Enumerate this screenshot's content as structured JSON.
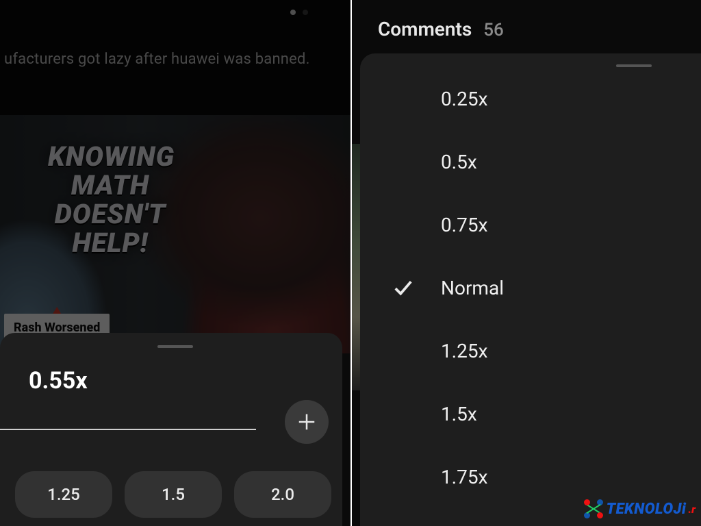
{
  "left": {
    "page_indicator": {
      "count": 2,
      "active": 0
    },
    "comment_preview": "ufacturers got lazy after huawei was banned.",
    "thumbnail": {
      "title_lines": [
        "KNOWING",
        "MATH",
        "DOESN'T",
        "HELP!"
      ],
      "badge": "Rash Worsened"
    },
    "speed_sheet": {
      "current": "0.55x",
      "plus_icon_name": "plus-icon",
      "chips": [
        "1.25",
        "1.5",
        "2.0"
      ]
    }
  },
  "right": {
    "header": {
      "label": "Comments",
      "count": "56"
    },
    "speed_options": [
      {
        "label": "0.25x",
        "selected": false
      },
      {
        "label": "0.5x",
        "selected": false
      },
      {
        "label": "0.75x",
        "selected": false
      },
      {
        "label": "Normal",
        "selected": true
      },
      {
        "label": "1.25x",
        "selected": false
      },
      {
        "label": "1.5x",
        "selected": false
      },
      {
        "label": "1.75x",
        "selected": false
      }
    ]
  },
  "watermark": {
    "word": "TEKNOLOJi",
    "suffix": ".r"
  }
}
